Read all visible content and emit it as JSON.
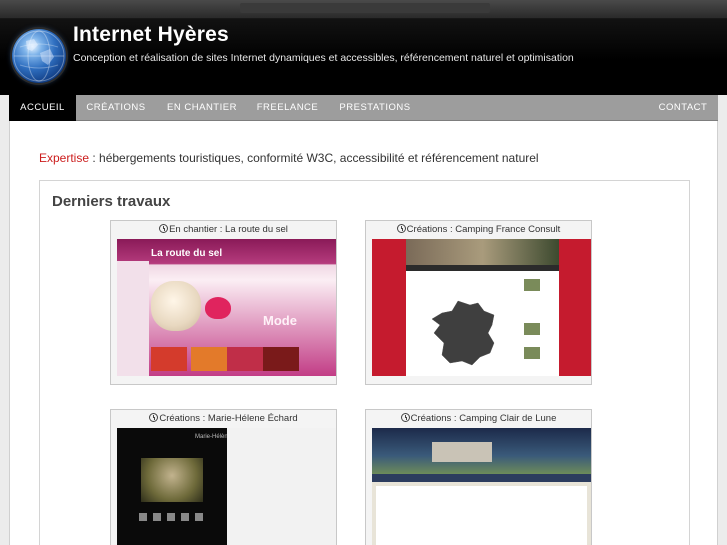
{
  "site": {
    "title": "Internet Hyères",
    "tagline": "Conception et réalisation de sites Internet dynamiques et accessibles, référencement naturel et optimisation"
  },
  "nav": {
    "items": [
      {
        "label": "ACCUEIL",
        "active": true
      },
      {
        "label": "CRÉATIONS",
        "active": false
      },
      {
        "label": "EN CHANTIER",
        "active": false
      },
      {
        "label": "FREELANCE",
        "active": false
      },
      {
        "label": "PRESTATIONS",
        "active": false
      },
      {
        "label": "CONTACT",
        "active": false
      }
    ]
  },
  "expertise": {
    "key": "Expertise",
    "text": " : hébergements touristiques, conformité W3C, accessibilité et référencement naturel"
  },
  "works": {
    "heading": "Derniers travaux",
    "items": [
      {
        "caption": "En chantier : La route du sel",
        "thumb": {
          "brand": "La route du sel",
          "badge": "Mode"
        }
      },
      {
        "caption": "Créations : Camping France Consult"
      },
      {
        "caption": "Créations : Marie-Hélene Échard",
        "thumb": {
          "header": "Marie-Hélène Échard"
        }
      },
      {
        "caption": "Créations : Camping Clair de Lune"
      }
    ]
  },
  "colors": {
    "accent": "#cc1d1d",
    "nav_bg": "#9d9d9d",
    "nav_active": "#000000",
    "header_bg": "#000000"
  },
  "icons": {
    "logo": "globe-icon",
    "caption": "clock-icon"
  }
}
